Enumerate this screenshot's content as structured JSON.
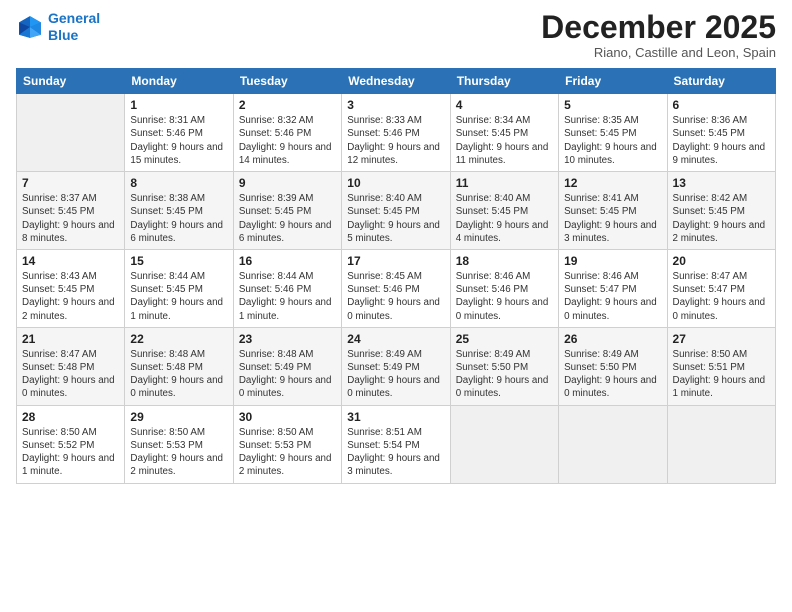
{
  "header": {
    "logo_line1": "General",
    "logo_line2": "Blue",
    "month": "December 2025",
    "location": "Riano, Castille and Leon, Spain"
  },
  "days_of_week": [
    "Sunday",
    "Monday",
    "Tuesday",
    "Wednesday",
    "Thursday",
    "Friday",
    "Saturday"
  ],
  "weeks": [
    [
      {
        "day": "",
        "sunrise": "",
        "sunset": "",
        "daylight": ""
      },
      {
        "day": "1",
        "sunrise": "Sunrise: 8:31 AM",
        "sunset": "Sunset: 5:46 PM",
        "daylight": "Daylight: 9 hours and 15 minutes."
      },
      {
        "day": "2",
        "sunrise": "Sunrise: 8:32 AM",
        "sunset": "Sunset: 5:46 PM",
        "daylight": "Daylight: 9 hours and 14 minutes."
      },
      {
        "day": "3",
        "sunrise": "Sunrise: 8:33 AM",
        "sunset": "Sunset: 5:46 PM",
        "daylight": "Daylight: 9 hours and 12 minutes."
      },
      {
        "day": "4",
        "sunrise": "Sunrise: 8:34 AM",
        "sunset": "Sunset: 5:45 PM",
        "daylight": "Daylight: 9 hours and 11 minutes."
      },
      {
        "day": "5",
        "sunrise": "Sunrise: 8:35 AM",
        "sunset": "Sunset: 5:45 PM",
        "daylight": "Daylight: 9 hours and 10 minutes."
      },
      {
        "day": "6",
        "sunrise": "Sunrise: 8:36 AM",
        "sunset": "Sunset: 5:45 PM",
        "daylight": "Daylight: 9 hours and 9 minutes."
      }
    ],
    [
      {
        "day": "7",
        "sunrise": "Sunrise: 8:37 AM",
        "sunset": "Sunset: 5:45 PM",
        "daylight": "Daylight: 9 hours and 8 minutes."
      },
      {
        "day": "8",
        "sunrise": "Sunrise: 8:38 AM",
        "sunset": "Sunset: 5:45 PM",
        "daylight": "Daylight: 9 hours and 6 minutes."
      },
      {
        "day": "9",
        "sunrise": "Sunrise: 8:39 AM",
        "sunset": "Sunset: 5:45 PM",
        "daylight": "Daylight: 9 hours and 6 minutes."
      },
      {
        "day": "10",
        "sunrise": "Sunrise: 8:40 AM",
        "sunset": "Sunset: 5:45 PM",
        "daylight": "Daylight: 9 hours and 5 minutes."
      },
      {
        "day": "11",
        "sunrise": "Sunrise: 8:40 AM",
        "sunset": "Sunset: 5:45 PM",
        "daylight": "Daylight: 9 hours and 4 minutes."
      },
      {
        "day": "12",
        "sunrise": "Sunrise: 8:41 AM",
        "sunset": "Sunset: 5:45 PM",
        "daylight": "Daylight: 9 hours and 3 minutes."
      },
      {
        "day": "13",
        "sunrise": "Sunrise: 8:42 AM",
        "sunset": "Sunset: 5:45 PM",
        "daylight": "Daylight: 9 hours and 2 minutes."
      }
    ],
    [
      {
        "day": "14",
        "sunrise": "Sunrise: 8:43 AM",
        "sunset": "Sunset: 5:45 PM",
        "daylight": "Daylight: 9 hours and 2 minutes."
      },
      {
        "day": "15",
        "sunrise": "Sunrise: 8:44 AM",
        "sunset": "Sunset: 5:45 PM",
        "daylight": "Daylight: 9 hours and 1 minute."
      },
      {
        "day": "16",
        "sunrise": "Sunrise: 8:44 AM",
        "sunset": "Sunset: 5:46 PM",
        "daylight": "Daylight: 9 hours and 1 minute."
      },
      {
        "day": "17",
        "sunrise": "Sunrise: 8:45 AM",
        "sunset": "Sunset: 5:46 PM",
        "daylight": "Daylight: 9 hours and 0 minutes."
      },
      {
        "day": "18",
        "sunrise": "Sunrise: 8:46 AM",
        "sunset": "Sunset: 5:46 PM",
        "daylight": "Daylight: 9 hours and 0 minutes."
      },
      {
        "day": "19",
        "sunrise": "Sunrise: 8:46 AM",
        "sunset": "Sunset: 5:47 PM",
        "daylight": "Daylight: 9 hours and 0 minutes."
      },
      {
        "day": "20",
        "sunrise": "Sunrise: 8:47 AM",
        "sunset": "Sunset: 5:47 PM",
        "daylight": "Daylight: 9 hours and 0 minutes."
      }
    ],
    [
      {
        "day": "21",
        "sunrise": "Sunrise: 8:47 AM",
        "sunset": "Sunset: 5:48 PM",
        "daylight": "Daylight: 9 hours and 0 minutes."
      },
      {
        "day": "22",
        "sunrise": "Sunrise: 8:48 AM",
        "sunset": "Sunset: 5:48 PM",
        "daylight": "Daylight: 9 hours and 0 minutes."
      },
      {
        "day": "23",
        "sunrise": "Sunrise: 8:48 AM",
        "sunset": "Sunset: 5:49 PM",
        "daylight": "Daylight: 9 hours and 0 minutes."
      },
      {
        "day": "24",
        "sunrise": "Sunrise: 8:49 AM",
        "sunset": "Sunset: 5:49 PM",
        "daylight": "Daylight: 9 hours and 0 minutes."
      },
      {
        "day": "25",
        "sunrise": "Sunrise: 8:49 AM",
        "sunset": "Sunset: 5:50 PM",
        "daylight": "Daylight: 9 hours and 0 minutes."
      },
      {
        "day": "26",
        "sunrise": "Sunrise: 8:49 AM",
        "sunset": "Sunset: 5:50 PM",
        "daylight": "Daylight: 9 hours and 0 minutes."
      },
      {
        "day": "27",
        "sunrise": "Sunrise: 8:50 AM",
        "sunset": "Sunset: 5:51 PM",
        "daylight": "Daylight: 9 hours and 1 minute."
      }
    ],
    [
      {
        "day": "28",
        "sunrise": "Sunrise: 8:50 AM",
        "sunset": "Sunset: 5:52 PM",
        "daylight": "Daylight: 9 hours and 1 minute."
      },
      {
        "day": "29",
        "sunrise": "Sunrise: 8:50 AM",
        "sunset": "Sunset: 5:53 PM",
        "daylight": "Daylight: 9 hours and 2 minutes."
      },
      {
        "day": "30",
        "sunrise": "Sunrise: 8:50 AM",
        "sunset": "Sunset: 5:53 PM",
        "daylight": "Daylight: 9 hours and 2 minutes."
      },
      {
        "day": "31",
        "sunrise": "Sunrise: 8:51 AM",
        "sunset": "Sunset: 5:54 PM",
        "daylight": "Daylight: 9 hours and 3 minutes."
      },
      {
        "day": "",
        "sunrise": "",
        "sunset": "",
        "daylight": ""
      },
      {
        "day": "",
        "sunrise": "",
        "sunset": "",
        "daylight": ""
      },
      {
        "day": "",
        "sunrise": "",
        "sunset": "",
        "daylight": ""
      }
    ]
  ]
}
